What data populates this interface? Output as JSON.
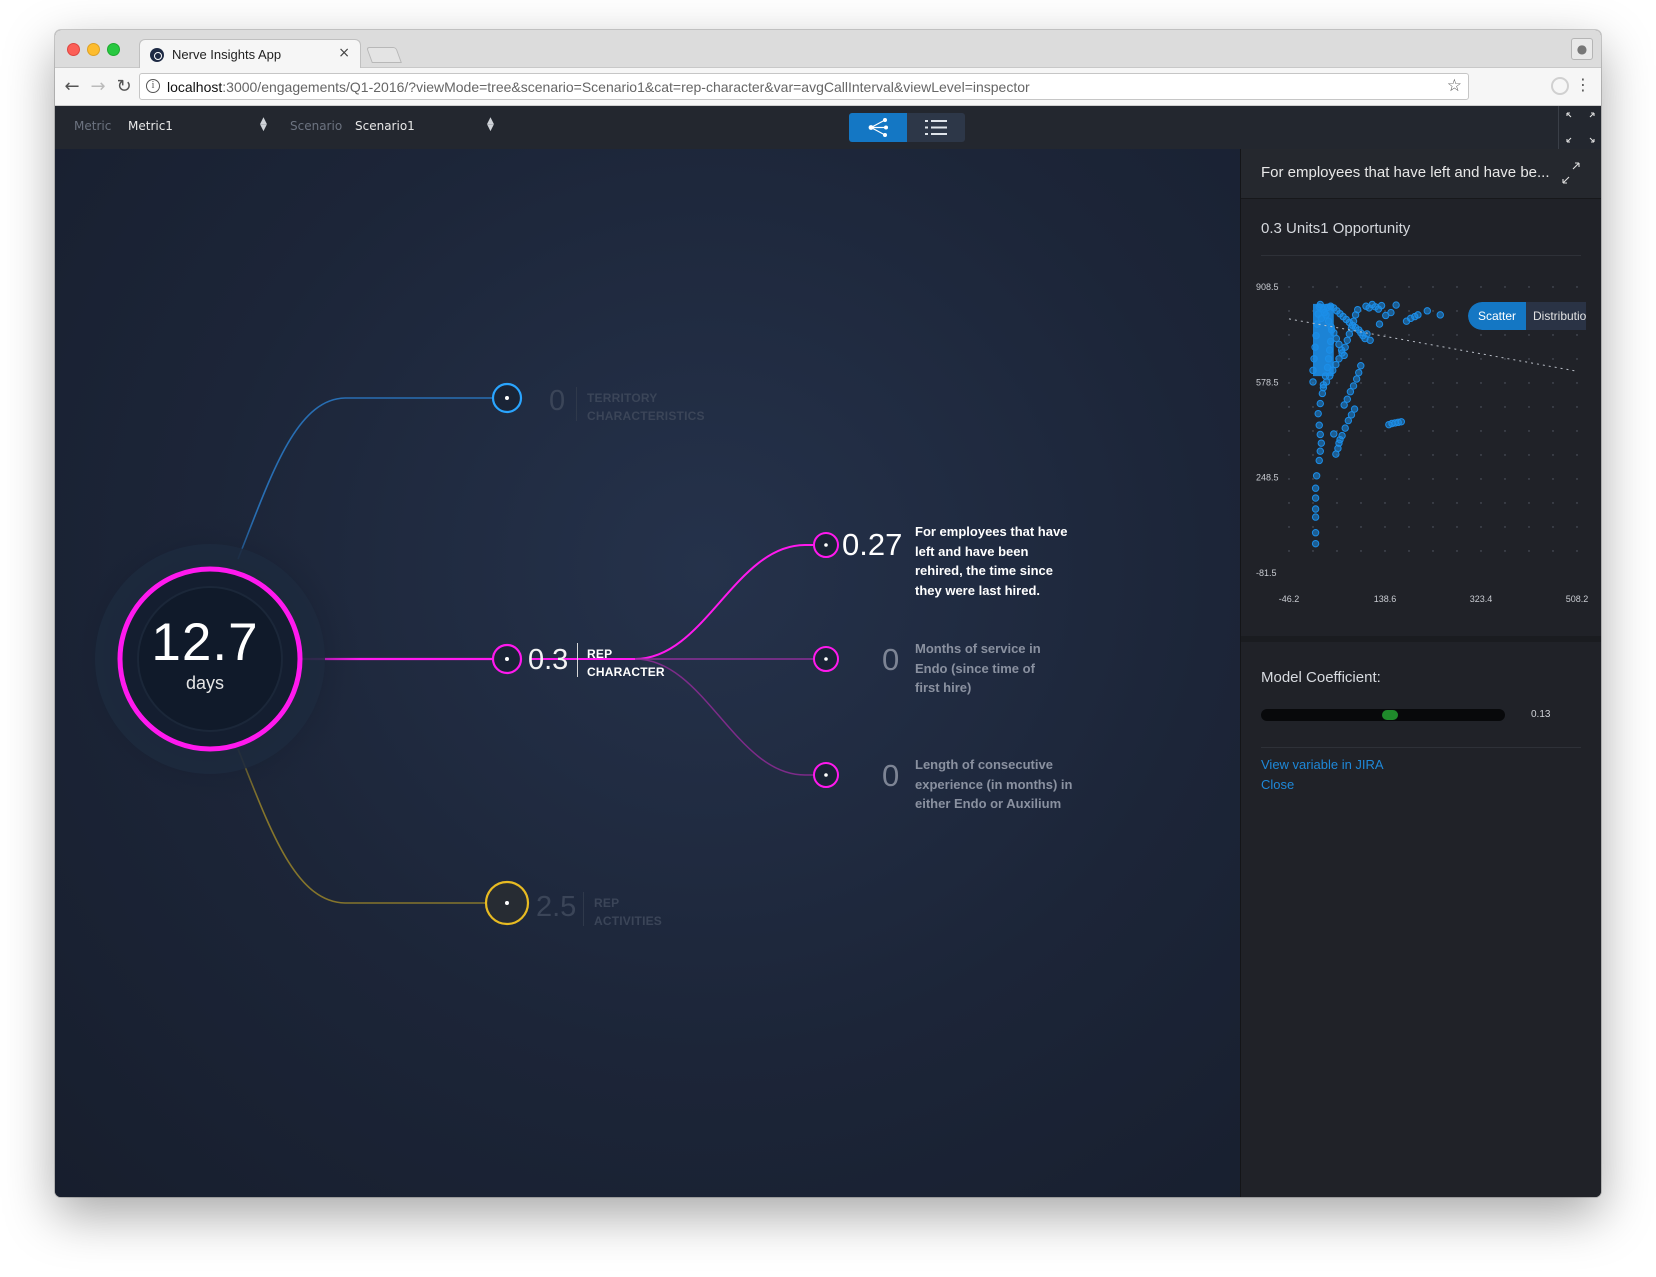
{
  "browser": {
    "tab_title": "Nerve Insights App",
    "tab_close": "×",
    "url_host": "localhost",
    "url_rest": ":3000/engagements/Q1-2016/?viewMode=tree&scenario=Scenario1&cat=rep-character&var=avgCallInterval&viewLevel=inspector",
    "icons": [
      "back-icon",
      "forward-icon",
      "reload-icon",
      "info-icon",
      "star-icon",
      "menu-icon",
      "profile-icon"
    ]
  },
  "appbar": {
    "metric_label": "Metric",
    "metric_value": "Metric1",
    "scenario_label": "Scenario",
    "scenario_value": "Scenario1",
    "active_view": "tree"
  },
  "tree": {
    "root": {
      "value": "12.7",
      "unit": "days",
      "color": "#ff19ee"
    },
    "categories": [
      {
        "id": "territory",
        "value": "0",
        "label_line1": "TERRITORY",
        "label_line2": "CHARACTERISTICS",
        "color": "#2aa5ff",
        "active": false
      },
      {
        "id": "rep-character",
        "value": "0.3",
        "label_line1": "REP",
        "label_line2": "CHARACTER",
        "color": "#ff19ee",
        "active": true
      },
      {
        "id": "rep-activities",
        "value": "2.5",
        "label_line1": "REP",
        "label_line2": "ACTIVITIES",
        "color": "#e8bb22",
        "active": false
      }
    ],
    "variables": [
      {
        "value": "0.27",
        "description": "For employees that have left and have been rehired, the time since they were last hired.",
        "selected": true
      },
      {
        "value": "0",
        "description": "Months of service in Endo (since time of first hire)",
        "selected": false
      },
      {
        "value": "0",
        "description": "Length of consecutive experience (in months) in either Endo or Auxilium",
        "selected": false
      }
    ]
  },
  "panel": {
    "title": "For employees that have left and have be...",
    "subtitle": "0.3 Units1 Opportunity",
    "chart_toggle": {
      "scatter": "Scatter",
      "distribution": "Distributio",
      "active": "scatter"
    },
    "coefficient_label": "Model Coefficient:",
    "coefficient_value": "0.13",
    "coefficient_fraction": 0.53,
    "link_jira": "View variable in JIRA",
    "link_close": "Close",
    "accent_color": "#1e88d8"
  },
  "chart_data": {
    "type": "scatter",
    "x_ticks": [
      "-46.2",
      "138.6",
      "323.4",
      "508.2"
    ],
    "y_ticks": [
      "908.5",
      "578.5",
      "248.5",
      "-81.5"
    ],
    "xlim": [
      -46.2,
      508.2
    ],
    "ylim": [
      -81.5,
      908.5
    ],
    "grid": "dotted",
    "trend_line": [
      [
        -46.2,
        798
      ],
      [
        508.2,
        617
      ]
    ],
    "point_color": "#1c8ee8",
    "points": [
      [
        5,
        20
      ],
      [
        5,
        58
      ],
      [
        5,
        112
      ],
      [
        5,
        140
      ],
      [
        5,
        178
      ],
      [
        5,
        212
      ],
      [
        7,
        255
      ],
      [
        12,
        308
      ],
      [
        14,
        340
      ],
      [
        16,
        368
      ],
      [
        14,
        398
      ],
      [
        12,
        430
      ],
      [
        10,
        470
      ],
      [
        14,
        505
      ],
      [
        18,
        540
      ],
      [
        20,
        570
      ],
      [
        24,
        600
      ],
      [
        28,
        630
      ],
      [
        30,
        660
      ],
      [
        32,
        690
      ],
      [
        34,
        720
      ],
      [
        36,
        760
      ],
      [
        0,
        580
      ],
      [
        0,
        620
      ],
      [
        2,
        660
      ],
      [
        4,
        700
      ],
      [
        6,
        740
      ],
      [
        8,
        780
      ],
      [
        10,
        815
      ],
      [
        12,
        840
      ],
      [
        14,
        848
      ],
      [
        20,
        832
      ],
      [
        25,
        812
      ],
      [
        30,
        790
      ],
      [
        35,
        770
      ],
      [
        40,
        750
      ],
      [
        45,
        730
      ],
      [
        50,
        710
      ],
      [
        55,
        690
      ],
      [
        60,
        672
      ],
      [
        20,
        560
      ],
      [
        26,
        580
      ],
      [
        32,
        600
      ],
      [
        38,
        620
      ],
      [
        44,
        640
      ],
      [
        50,
        660
      ],
      [
        56,
        680
      ],
      [
        62,
        700
      ],
      [
        66,
        724
      ],
      [
        70,
        746
      ],
      [
        74,
        766
      ],
      [
        78,
        790
      ],
      [
        82,
        812
      ],
      [
        86,
        830
      ],
      [
        16,
        800
      ],
      [
        22,
        820
      ],
      [
        28,
        838
      ],
      [
        34,
        842
      ],
      [
        40,
        836
      ],
      [
        46,
        826
      ],
      [
        52,
        816
      ],
      [
        58,
        806
      ],
      [
        64,
        796
      ],
      [
        70,
        786
      ],
      [
        76,
        776
      ],
      [
        82,
        768
      ],
      [
        88,
        760
      ],
      [
        92,
        750
      ],
      [
        96,
        740
      ],
      [
        100,
        730
      ],
      [
        50,
        368
      ],
      [
        56,
        394
      ],
      [
        62,
        420
      ],
      [
        68,
        446
      ],
      [
        74,
        466
      ],
      [
        80,
        486
      ],
      [
        60,
        500
      ],
      [
        66,
        520
      ],
      [
        72,
        546
      ],
      [
        78,
        566
      ],
      [
        84,
        590
      ],
      [
        88,
        612
      ],
      [
        92,
        636
      ],
      [
        44,
        330
      ],
      [
        48,
        350
      ],
      [
        52,
        380
      ],
      [
        40,
        400
      ],
      [
        102,
        842
      ],
      [
        108,
        836
      ],
      [
        114,
        848
      ],
      [
        120,
        840
      ],
      [
        126,
        832
      ],
      [
        132,
        844
      ],
      [
        150,
        820
      ],
      [
        160,
        846
      ],
      [
        140,
        810
      ],
      [
        128,
        780
      ],
      [
        104,
        746
      ],
      [
        110,
        724
      ],
      [
        180,
        790
      ],
      [
        188,
        800
      ],
      [
        196,
        806
      ],
      [
        202,
        812
      ],
      [
        146,
        432
      ],
      [
        152,
        436
      ],
      [
        158,
        438
      ],
      [
        164,
        440
      ],
      [
        170,
        442
      ],
      [
        220,
        826
      ],
      [
        245,
        812
      ],
      [
        410,
        780
      ],
      [
        450,
        780
      ]
    ]
  }
}
